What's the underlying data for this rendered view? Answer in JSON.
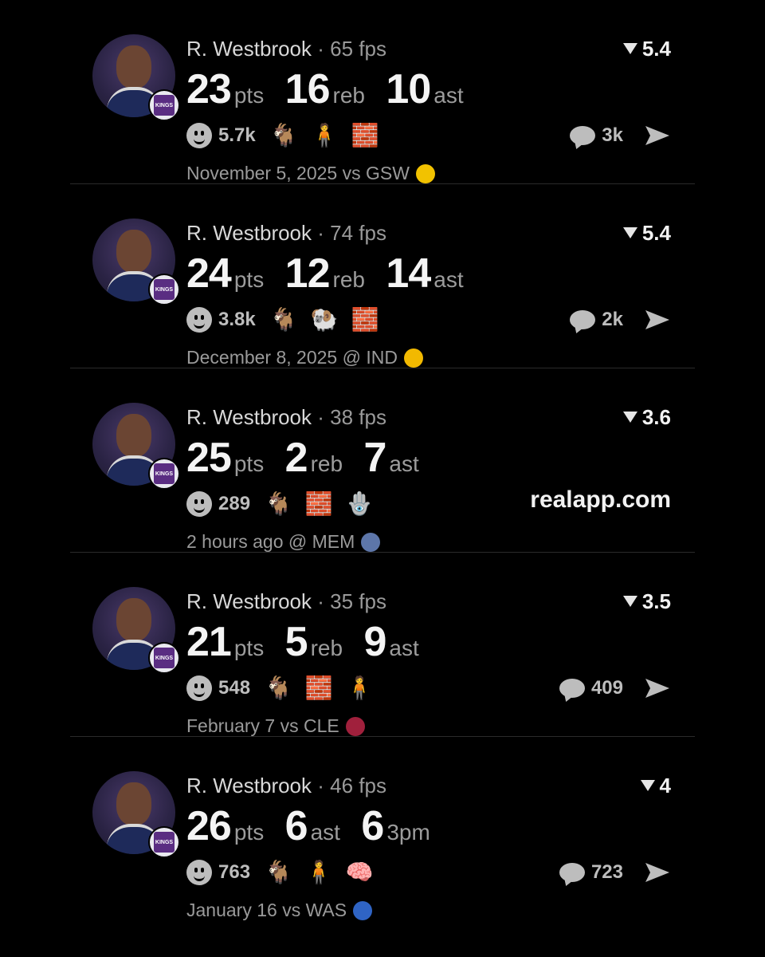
{
  "promo_text": "realapp.com",
  "cards": [
    {
      "player": "R. Westbrook",
      "sep": "·",
      "fps": "65 fps",
      "rating": "5.4",
      "stats": [
        {
          "num": "23",
          "unit": "pts"
        },
        {
          "num": "16",
          "unit": "reb"
        },
        {
          "num": "10",
          "unit": "ast"
        }
      ],
      "reaction_count": "5.7k",
      "emojis": [
        "🐐",
        "🧍",
        "🧱"
      ],
      "comments": "3k",
      "date": "November 5, 2025 vs GSW",
      "logo_color": "#f2c200"
    },
    {
      "player": "R. Westbrook",
      "sep": "·",
      "fps": "74 fps",
      "rating": "5.4",
      "stats": [
        {
          "num": "24",
          "unit": "pts"
        },
        {
          "num": "12",
          "unit": "reb"
        },
        {
          "num": "14",
          "unit": "ast"
        }
      ],
      "reaction_count": "3.8k",
      "emojis": [
        "🐐",
        "🐏",
        "🧱"
      ],
      "comments": "2k",
      "date": "December 8, 2025 @ IND",
      "logo_color": "#f2b900"
    },
    {
      "player": "R. Westbrook",
      "sep": "·",
      "fps": "38 fps",
      "rating": "3.6",
      "stats": [
        {
          "num": "25",
          "unit": "pts"
        },
        {
          "num": "2",
          "unit": "reb"
        },
        {
          "num": "7",
          "unit": "ast"
        }
      ],
      "reaction_count": "289",
      "emojis": [
        "🐐",
        "🧱",
        "🪬"
      ],
      "comments": "",
      "date": "2 hours ago @ MEM",
      "logo_color": "#5d76a9"
    },
    {
      "player": "R. Westbrook",
      "sep": "·",
      "fps": "35 fps",
      "rating": "3.5",
      "stats": [
        {
          "num": "21",
          "unit": "pts"
        },
        {
          "num": "5",
          "unit": "reb"
        },
        {
          "num": "9",
          "unit": "ast"
        }
      ],
      "reaction_count": "548",
      "emojis": [
        "🐐",
        "🧱",
        "🧍"
      ],
      "comments": "409",
      "date": "February 7 vs CLE",
      "logo_color": "#a0203c"
    },
    {
      "player": "R. Westbrook",
      "sep": "·",
      "fps": "46 fps",
      "rating": "4",
      "stats": [
        {
          "num": "26",
          "unit": "pts"
        },
        {
          "num": "6",
          "unit": "ast"
        },
        {
          "num": "6",
          "unit": "3pm"
        }
      ],
      "reaction_count": "763",
      "emojis": [
        "🐐",
        "🧍",
        "🧠"
      ],
      "comments": "723",
      "date": "January 16 vs WAS",
      "logo_color": "#2f64c4"
    }
  ]
}
